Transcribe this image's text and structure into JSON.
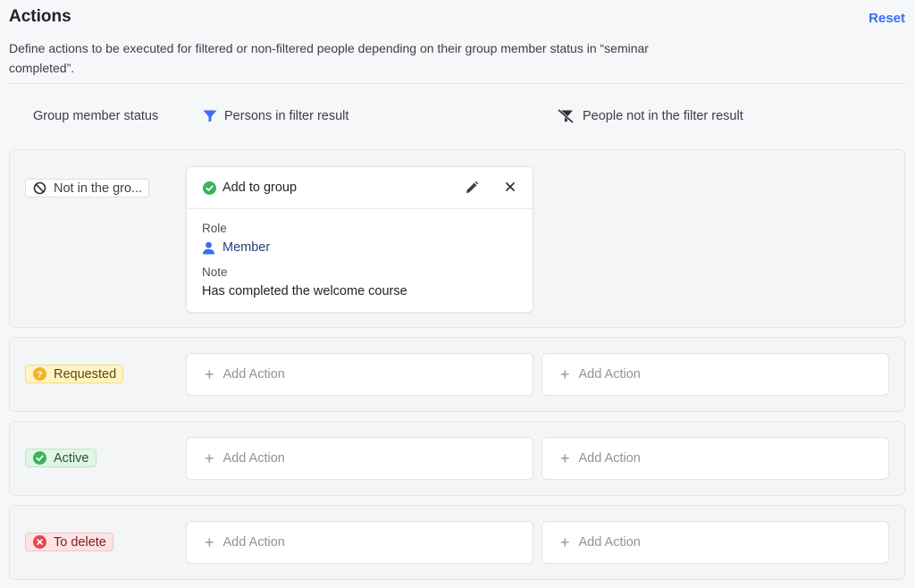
{
  "header": {
    "title": "Actions",
    "reset_label": "Reset",
    "description": "Define actions to be executed for filtered or non-filtered people depending on their group member status in “seminar completed”."
  },
  "columns": {
    "status": "Group member status",
    "in_filter": "Persons in filter result",
    "not_in_filter": "People not in the filter result"
  },
  "rows": {
    "not_in_group": {
      "status_label": "Not in the gro...",
      "action": {
        "title": "Add to group",
        "role_label": "Role",
        "role_value": "Member",
        "note_label": "Note",
        "note_value": "Has completed the welcome course"
      }
    },
    "requested": {
      "status_label": "Requested",
      "add_in": "Add Action",
      "add_out": "Add Action"
    },
    "active": {
      "status_label": "Active",
      "add_in": "Add Action",
      "add_out": "Add Action"
    },
    "to_delete": {
      "status_label": "To delete",
      "add_in": "Add Action",
      "add_out": "Add Action"
    }
  },
  "colors": {
    "accent": "#3a6ff0",
    "success": "#3cb35a",
    "warning": "#f0b429",
    "danger": "#e5484d"
  },
  "icons": {
    "filter": "filter-icon",
    "filter_off": "filter-off-icon",
    "ban": "ban-icon",
    "question": "question-circle-icon",
    "check": "check-circle-icon",
    "x_circle": "x-circle-icon",
    "edit": "pencil-icon",
    "close": "close-icon",
    "person": "person-icon",
    "plus": "plus-icon"
  }
}
